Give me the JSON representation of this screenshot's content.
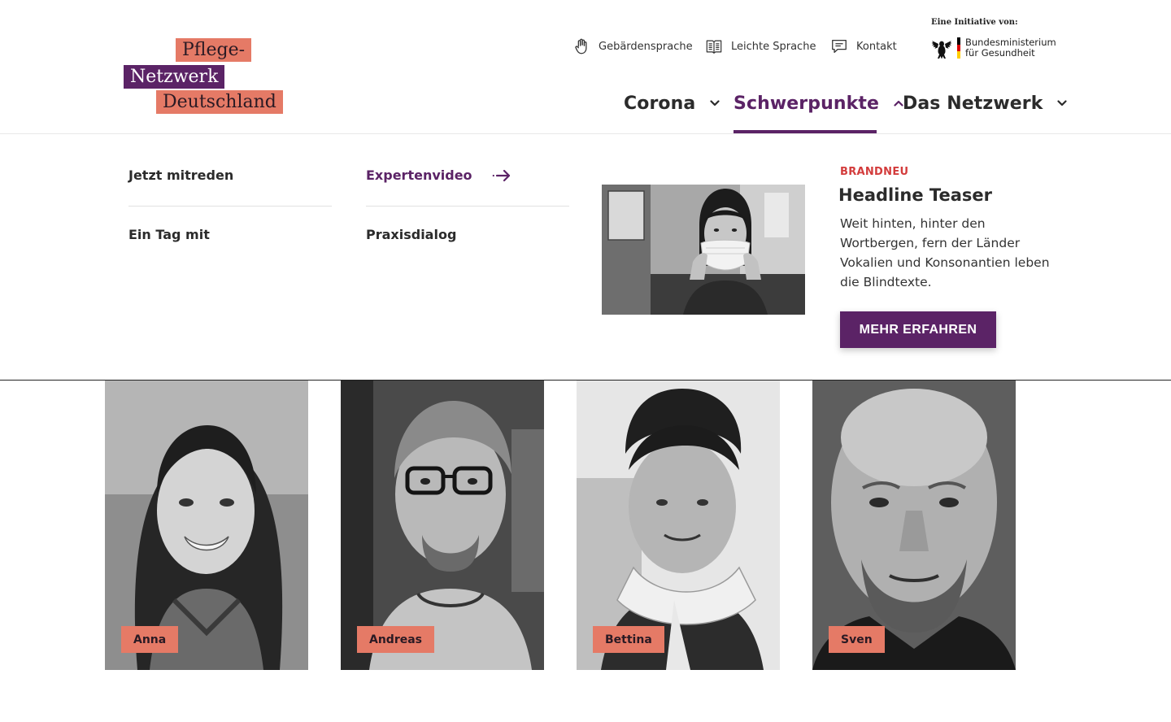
{
  "logo": {
    "line1": "Pflege-",
    "line2": "Netzwerk",
    "line3": "Deutschland"
  },
  "service_nav": [
    {
      "label": "Gebärdensprache",
      "icon": "sign-language-hand-icon"
    },
    {
      "label": "Leichte Sprache",
      "icon": "easy-language-book-icon"
    },
    {
      "label": "Kontakt",
      "icon": "speech-bubble-icon"
    }
  ],
  "initiative": {
    "label": "Eine Initiative von:",
    "ministry_line1": "Bundesministerium",
    "ministry_line2": "für Gesundheit"
  },
  "main_nav": [
    {
      "label": "Corona",
      "state": "collapsed"
    },
    {
      "label": "Schwerpunkte",
      "state": "expanded"
    },
    {
      "label": "Das Netzwerk",
      "state": "collapsed"
    }
  ],
  "mega_menu": {
    "links": [
      {
        "label": "Jetzt mitreden"
      },
      {
        "label": "Expertenvideo",
        "active": true
      },
      {
        "label": "Ein Tag mit"
      },
      {
        "label": "Praxisdialog"
      }
    ],
    "teaser": {
      "kicker": "BRANDNEU",
      "headline": "Headline Teaser",
      "text": "Weit hinten, hinter den Wortbergen, fern der Länder Vokalien und Konsonantien leben die Blindtexte.",
      "cta": "MEHR ERFAHREN"
    }
  },
  "people": [
    {
      "name": "Anna"
    },
    {
      "name": "Andreas"
    },
    {
      "name": "Bettina"
    },
    {
      "name": "Sven"
    }
  ],
  "colors": {
    "brand_purple": "#5b2366",
    "brand_salmon": "#e57a66",
    "kicker_red": "#d33c3c",
    "text_dark": "#2b2b2b"
  }
}
